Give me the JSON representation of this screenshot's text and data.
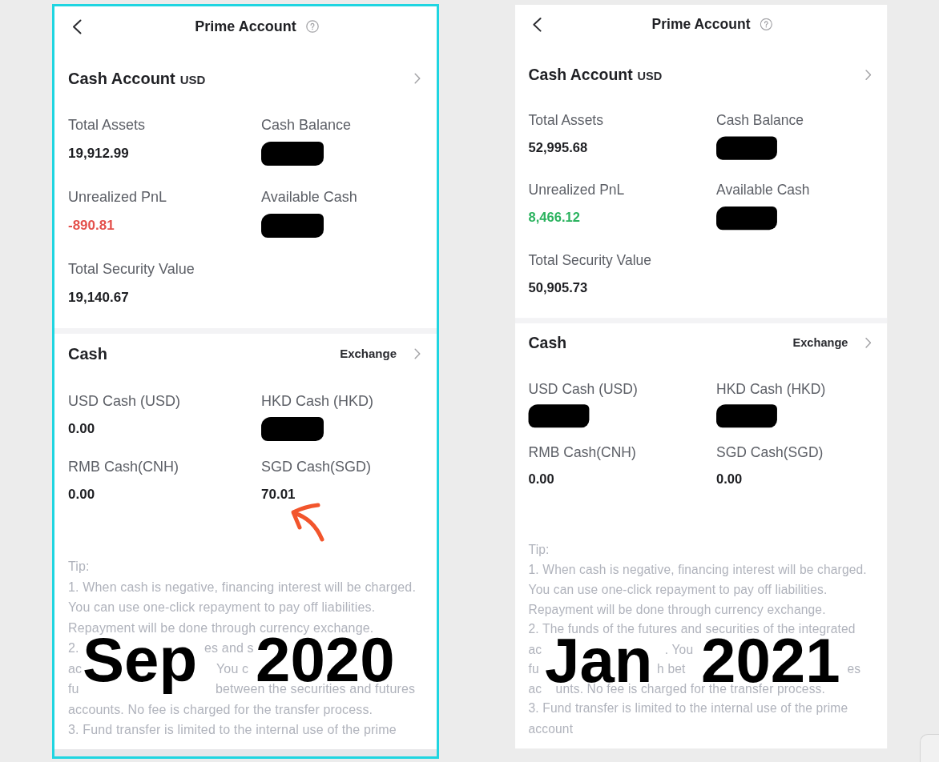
{
  "panels": [
    {
      "highlighted": true,
      "caption": [
        "Sep",
        "2020"
      ],
      "header": {
        "title": "Prime Account"
      },
      "account": {
        "title": "Cash Account",
        "currency": "USD"
      },
      "metrics": [
        {
          "label": "Total Assets",
          "value": "19,912.99",
          "color": "#1d1e22",
          "redacted": false
        },
        {
          "label": "Cash Balance",
          "redacted": true
        },
        {
          "label": "Unrealized PnL",
          "value": "-890.81",
          "color": "#e4514c",
          "redacted": false
        },
        {
          "label": "Available Cash",
          "redacted": true
        },
        {
          "label": "Total Security Value",
          "value": "19,140.67",
          "color": "#1d1e22",
          "redacted": false
        }
      ],
      "cash": {
        "title": "Cash",
        "action": "Exchange",
        "items": [
          {
            "label": "USD Cash (USD)",
            "value": "0.00",
            "redacted": false,
            "annotated": false
          },
          {
            "label": "HKD Cash (HKD)",
            "redacted": true,
            "annotated": false
          },
          {
            "label": "RMB Cash(CNH)",
            "value": "0.00",
            "redacted": false,
            "annotated": false
          },
          {
            "label": "SGD Cash(SGD)",
            "value": "70.01",
            "redacted": false,
            "annotated": true
          }
        ]
      },
      "tip": {
        "lines": [
          [
            "Tip:"
          ],
          [
            "1. When cash is negative, financing interest will be charged."
          ],
          [
            "You can use one-click repayment to pay off liabilities."
          ],
          [
            "Repayment will be done through currency exchange."
          ],
          [
            "2.",
            "es and s"
          ],
          [
            "ac",
            "You c"
          ],
          [
            "fu",
            "between the securities and futures"
          ],
          [
            "accounts. No fee is charged for the transfer process."
          ],
          [
            "3. Fund transfer is limited to the internal use of the prime"
          ]
        ]
      }
    },
    {
      "highlighted": false,
      "caption": [
        "Jan",
        "2021"
      ],
      "header": {
        "title": "Prime Account"
      },
      "account": {
        "title": "Cash Account",
        "currency": "USD"
      },
      "metrics": [
        {
          "label": "Total Assets",
          "value": "52,995.68",
          "color": "#1d1e22",
          "redacted": false
        },
        {
          "label": "Cash Balance",
          "redacted": true
        },
        {
          "label": "Unrealized PnL",
          "value": "8,466.12",
          "color": "#2bb35f",
          "redacted": false
        },
        {
          "label": "Available Cash",
          "redacted": true
        },
        {
          "label": "Total Security Value",
          "value": "50,905.73",
          "color": "#1d1e22",
          "redacted": false
        }
      ],
      "cash": {
        "title": "Cash",
        "action": "Exchange",
        "items": [
          {
            "label": "USD Cash (USD)",
            "redacted": true,
            "annotated": false
          },
          {
            "label": "HKD Cash (HKD)",
            "redacted": true,
            "annotated": false
          },
          {
            "label": "RMB Cash(CNH)",
            "value": "0.00",
            "redacted": false,
            "annotated": false
          },
          {
            "label": "SGD Cash(SGD)",
            "value": "0.00",
            "redacted": false,
            "annotated": false
          }
        ]
      },
      "tip": {
        "lines": [
          [
            "Tip:"
          ],
          [
            "1. When cash is negative, financing interest will be charged."
          ],
          [
            "You can use one-click repayment to pay off liabilities."
          ],
          [
            "Repayment will be done through currency exchange."
          ],
          [
            "2. The funds of the futures and securities of the integrated"
          ],
          [
            "ac",
            ". You"
          ],
          [
            "fu",
            "h bet",
            "es"
          ],
          [
            "ac",
            "unts. No fee is charged for the transfer process."
          ],
          [
            "3. Fund transfer is limited to the internal use of the prime"
          ],
          [
            "account"
          ]
        ]
      }
    }
  ]
}
